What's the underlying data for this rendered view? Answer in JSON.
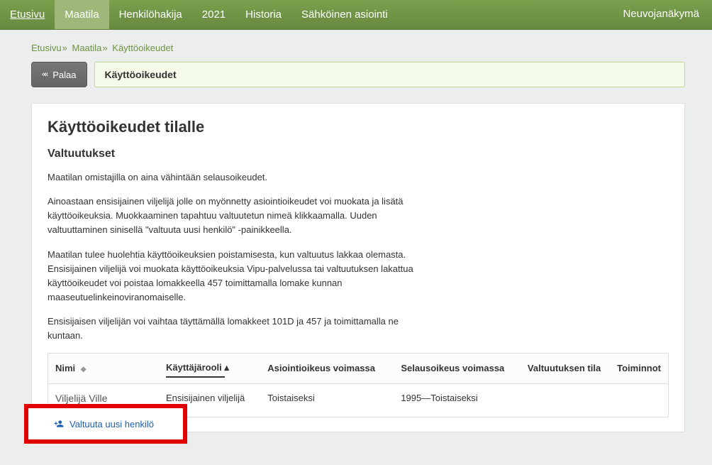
{
  "nav": {
    "items": [
      {
        "label": "Etusivu",
        "active": false,
        "underline": true
      },
      {
        "label": "Maatila",
        "active": true,
        "underline": false
      },
      {
        "label": "Henkilöhakija",
        "active": false,
        "underline": false
      },
      {
        "label": "2021",
        "active": false,
        "underline": false
      },
      {
        "label": "Historia",
        "active": false,
        "underline": false
      },
      {
        "label": "Sähköinen asiointi",
        "active": false,
        "underline": false
      }
    ],
    "right": "Neuvojanäkymä"
  },
  "breadcrumb": {
    "items": [
      {
        "label": "Etusivu"
      },
      {
        "label": "Maatila"
      },
      {
        "label": "Käyttöoikeudet"
      }
    ]
  },
  "back_label": "Palaa",
  "page_title": "Käyttöoikeudet",
  "h1": "Käyttöoikeudet tilalle",
  "h2": "Valtuutukset",
  "p1": "Maatilan omistajilla on aina vähintään selausoikeudet.",
  "p2": "Ainoastaan ensisijainen viljelijä jolle on myönnetty asiointioikeudet voi muokata ja lisätä käyttöoikeuksia. Muokkaaminen tapahtuu valtuutetun nimeä klikkaamalla. Uuden valtuuttaminen sinisellä \"valtuuta uusi henkilö\" -painikkeella.",
  "p3": "Maatilan tulee huolehtia käyttöoikeuksien poistamisesta, kun valtuutus lakkaa olemasta. Ensisijainen viljelijä voi muokata käyttöoikeuksia Vipu-palvelussa tai valtuutuksen lakattua käyttöoikeudet voi poistaa lomakkeella 457 toimittamalla lomake kunnan maaseutuelinkeinoviranomaiselle.",
  "p4": "Ensisijaisen viljelijän voi vaihtaa täyttämällä lomakkeet 101D ja 457 ja toimittamalla ne kuntaan.",
  "table": {
    "headers": {
      "name": "Nimi",
      "role": "Käyttäjärooli",
      "asiointi": "Asiointioikeus voimassa",
      "selaus": "Selausoikeus voimassa",
      "tila": "Valtuutuksen tila",
      "toiminnot": "Toiminnot"
    },
    "rows": [
      {
        "name": "Viljelijä Ville",
        "role": "Ensisijainen viljelijä",
        "asiointi": "Toistaiseksi",
        "selaus": "1995—Toistaiseksi",
        "tila": "",
        "toiminnot": ""
      }
    ]
  },
  "add_link": "Valtuuta uusi henkilö"
}
